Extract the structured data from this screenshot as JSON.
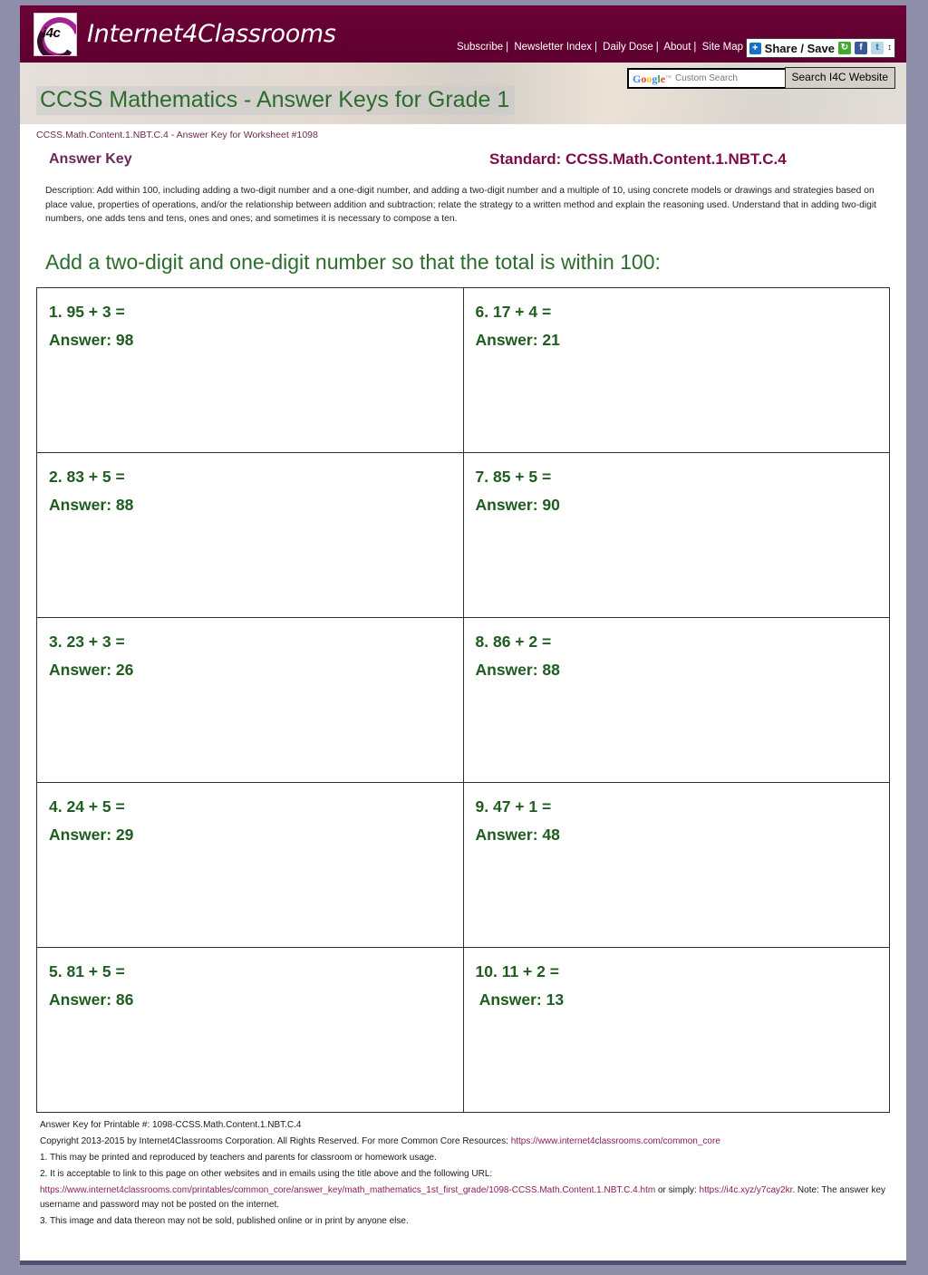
{
  "site": {
    "logo_text": "Internet4Classrooms",
    "logo_badge": "i4c"
  },
  "topnav": {
    "items": [
      {
        "label": "Subscribe"
      },
      {
        "label": "Newsletter Index"
      },
      {
        "label": "Daily Dose"
      },
      {
        "label": "About"
      },
      {
        "label": "Site Map"
      }
    ],
    "separator": "|"
  },
  "share": {
    "label": "Share / Save",
    "plus": "+",
    "icons": [
      "share-green-icon",
      "facebook-icon",
      "twitter-icon"
    ],
    "arrows": "↕"
  },
  "search": {
    "google_word": "Google",
    "tm": "™",
    "placeholder": "Custom Search",
    "value": "",
    "button_label": "Search I4C Website"
  },
  "header": {
    "page_title": "CCSS Mathematics - Answer Keys for Grade 1",
    "sub_id": "CCSS.Math.Content.1.NBT.C.4 - Answer Key for Worksheet #1098"
  },
  "answer_key": {
    "label": "Answer Key",
    "standard_label": "Standard: CCSS.Math.Content.1.NBT.C.4",
    "description": "Description: Add within 100, including adding a two-digit number and a one-digit number, and adding a two-digit number and a multiple of 10, using concrete models or drawings and strategies based on place value, properties of operations, and/or the relationship between addition and subtraction; relate the strategy to a written method and explain the reasoning used. Understand that in adding two-digit numbers, one adds tens and tens, ones and ones; and sometimes it is necessary to compose a ten.",
    "instruction": "Add a two-digit and one-digit number so that the total is within 100:"
  },
  "problems": [
    {
      "question": "1. 95 + 3 =",
      "answer": "Answer: 98"
    },
    {
      "question": "6. 17 + 4 =",
      "answer": "Answer: 21"
    },
    {
      "question": "2. 83 + 5 =",
      "answer": "Answer: 88"
    },
    {
      "question": "7. 85 + 5 =",
      "answer": "Answer: 90"
    },
    {
      "question": "3. 23 + 3 =",
      "answer": "Answer: 26"
    },
    {
      "question": "8. 86 + 2 =",
      "answer": "Answer: 88"
    },
    {
      "question": "4. 24 + 5 =",
      "answer": "Answer: 29"
    },
    {
      "question": "9. 47 + 1 =",
      "answer": "Answer: 48"
    },
    {
      "question": "5. 81 + 5 =",
      "answer": "Answer: 86"
    },
    {
      "question": "10. 11 + 2 =",
      "answer": " Answer: 13"
    }
  ],
  "footer": {
    "printable_line": "Answer Key for Printable #: 1098-CCSS.Math.Content.1.NBT.C.4",
    "copyright_prefix": "Copyright 2013-2015 by Internet4Classrooms Corporation. All Rights Reserved. For more Common Core Resources: ",
    "copyright_link": "https://www.internet4classrooms.com/common_core",
    "note1": "1. This may be printed and reproduced by teachers and parents for classroom or homework usage.",
    "note2": "2. It is acceptable to link to this page on other websites and in emails using the title above and the following URL:",
    "note2_url": "https://www.internet4classrooms.com/printables/common_core/answer_key/math_mathematics_1st_first_grade/1098-CCSS.Math.Content.1.NBT.C.4.htm",
    "note2_mid": " or simply: ",
    "note2_short_url": "https://i4c.xyz/y7cay2kr",
    "note2_tail": ". Note: The answer key username and password may not be posted on the internet.",
    "note3": "3. This image and data thereon may not be sold, published online or in print by anyone else."
  }
}
